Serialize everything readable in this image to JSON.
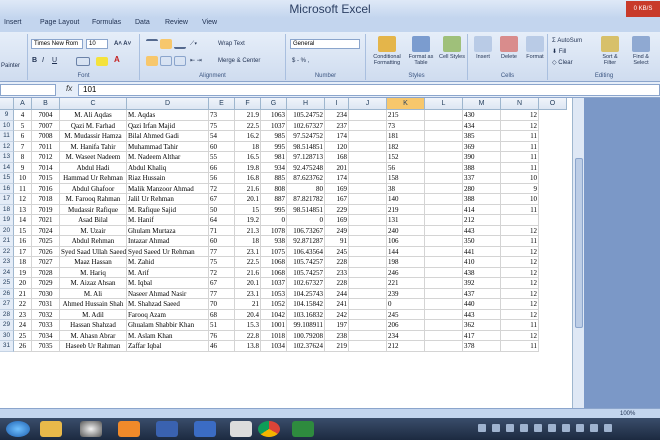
{
  "window": {
    "title": "Microsoft Excel",
    "speed": "0 KB/S"
  },
  "tabs": [
    "Insert",
    "Page Layout",
    "Formulas",
    "Data",
    "Review",
    "View"
  ],
  "ribbon": {
    "painter": "Painter",
    "font_name": "Times New Rom",
    "font_size": "10",
    "group_font": "Font",
    "wrap_text": "Wrap Text",
    "merge_center": "Merge & Center",
    "group_alignment": "Alignment",
    "number_format": "General",
    "number_symbols": "$ - % ,",
    "group_number": "Number",
    "conditional_formatting": "Conditional Formatting",
    "format_as_table": "Format as Table",
    "cell_styles": "Cell Styles",
    "group_styles": "Styles",
    "insert": "Insert",
    "delete": "Delete",
    "format": "Format",
    "group_cells": "Cells",
    "autosum": "AutoSum",
    "fill": "Fill",
    "clear": "Clear",
    "sort_filter": "Sort & Filter",
    "find_select": "Find & Select",
    "group_editing": "Editing"
  },
  "formula_bar": {
    "fx": "fx",
    "value": "101"
  },
  "columns": [
    "A",
    "B",
    "C",
    "D",
    "E",
    "F",
    "G",
    "H",
    "I",
    "J",
    "K",
    "L",
    "M",
    "N",
    "O"
  ],
  "rows": [
    [
      "9",
      "4",
      "7004",
      "M. Ali Aqdas",
      "M. Aqdas",
      "73",
      "21.9",
      "1063",
      "105.24752",
      "234",
      "",
      "215",
      "",
      "430",
      "12"
    ],
    [
      "10",
      "5",
      "7007",
      "Qazi M. Farhad",
      "Qazi Irfan Majid",
      "75",
      "22.5",
      "1037",
      "102.67327",
      "237",
      "",
      "73",
      "",
      "434",
      "12"
    ],
    [
      "11",
      "6",
      "7008",
      "M. Mudassir Hamza",
      "Bilal Ahmed Gadi",
      "54",
      "16.2",
      "985",
      "97.524752",
      "174",
      "",
      "181",
      "",
      "385",
      "11"
    ],
    [
      "12",
      "7",
      "7011",
      "M. Hanifa Tahir",
      "Muhammad Tahir",
      "60",
      "18",
      "995",
      "98.514851",
      "120",
      "",
      "182",
      "",
      "369",
      "11"
    ],
    [
      "13",
      "8",
      "7012",
      "M. Waseet Nadeem",
      "M. Nadeem Althar",
      "55",
      "16.5",
      "981",
      "97.128713",
      "168",
      "",
      "152",
      "",
      "390",
      "11"
    ],
    [
      "14",
      "9",
      "7014",
      "Abdul Hadi",
      "Abdul Khaliq",
      "66",
      "19.8",
      "934",
      "92.475248",
      "201",
      "",
      "56",
      "",
      "388",
      "11"
    ],
    [
      "15",
      "10",
      "7015",
      "Hammad Ur Rehman",
      "Riaz Hussain",
      "56",
      "16.8",
      "885",
      "87.623762",
      "174",
      "",
      "158",
      "",
      "337",
      "10"
    ],
    [
      "16",
      "11",
      "7016",
      "Abdul Ghafoor",
      "Malik Manzoor Ahmad",
      "72",
      "21.6",
      "808",
      "80",
      "169",
      "",
      "38",
      "",
      "280",
      "9"
    ],
    [
      "17",
      "12",
      "7018",
      "M. Farooq Rahman",
      "Jalil Ur Rehman",
      "67",
      "20.1",
      "887",
      "87.821782",
      "167",
      "",
      "140",
      "",
      "388",
      "10"
    ],
    [
      "18",
      "13",
      "7019",
      "Mudassir Rafique",
      "M. Rafique Sajid",
      "50",
      "15",
      "995",
      "98.514851",
      "229",
      "",
      "219",
      "",
      "414",
      "11"
    ],
    [
      "19",
      "14",
      "7021",
      "Asad Bilal",
      "M. Hanif",
      "64",
      "19.2",
      "0",
      "0",
      "169",
      "",
      "131",
      "",
      "212",
      ""
    ],
    [
      "20",
      "15",
      "7024",
      "M. Uzair",
      "Ghulam Murtaza",
      "71",
      "21.3",
      "1078",
      "106.73267",
      "249",
      "",
      "240",
      "",
      "443",
      "12"
    ],
    [
      "21",
      "16",
      "7025",
      "Abdul Rehman",
      "Intazar Ahmad",
      "60",
      "18",
      "938",
      "92.871287",
      "91",
      "",
      "106",
      "",
      "350",
      "11"
    ],
    [
      "22",
      "17",
      "7026",
      "Syed Saad Ullah Saeed",
      "Syed Saeed Ur Rehman",
      "77",
      "23.1",
      "1075",
      "106.43564",
      "245",
      "",
      "144",
      "",
      "441",
      "12"
    ],
    [
      "23",
      "18",
      "7027",
      "Maaz Hassan",
      "M. Zahid",
      "75",
      "22.5",
      "1068",
      "105.74257",
      "228",
      "",
      "198",
      "",
      "410",
      "12"
    ],
    [
      "24",
      "19",
      "7028",
      "M. Hariq",
      "M. Arif",
      "72",
      "21.6",
      "1068",
      "105.74257",
      "233",
      "",
      "246",
      "",
      "438",
      "12"
    ],
    [
      "25",
      "20",
      "7029",
      "M. Aizaz Ahsan",
      "M. Iqbal",
      "67",
      "20.1",
      "1037",
      "102.67327",
      "228",
      "",
      "221",
      "",
      "392",
      "12"
    ],
    [
      "26",
      "21",
      "7030",
      "M. Ali",
      "Naseer Ahmad Nasir",
      "77",
      "23.1",
      "1053",
      "104.25743",
      "244",
      "",
      "239",
      "",
      "437",
      "12"
    ],
    [
      "27",
      "22",
      "7031",
      "Ahmed Hussain Shah",
      "M. Shahzad Saeed",
      "70",
      "21",
      "1052",
      "104.15842",
      "241",
      "",
      "0",
      "",
      "440",
      "12"
    ],
    [
      "28",
      "23",
      "7032",
      "M. Adil",
      "Farooq Azam",
      "68",
      "20.4",
      "1042",
      "103.16832",
      "242",
      "",
      "245",
      "",
      "443",
      "12"
    ],
    [
      "29",
      "24",
      "7033",
      "Hassan Shahzad",
      "Ghualam Shabbir Khan",
      "51",
      "15.3",
      "1001",
      "99.108911",
      "197",
      "",
      "206",
      "",
      "362",
      "11"
    ],
    [
      "30",
      "25",
      "7034",
      "M. Ahasn Abrar",
      "M. Aslam Khan",
      "76",
      "22.8",
      "1018",
      "100.79208",
      "238",
      "",
      "234",
      "",
      "417",
      "12"
    ],
    [
      "31",
      "26",
      "7035",
      "Haseeb Ur Rahman",
      "Zaffar Iqbal",
      "46",
      "13.8",
      "1034",
      "102.37624",
      "219",
      "",
      "212",
      "",
      "378",
      "11"
    ]
  ],
  "status": {
    "zoom": "100%"
  },
  "colors": {
    "accent": "#4a6fa5",
    "selected_header": "#f7c76c",
    "ribbon": "#dfe9f7"
  },
  "taskbar_icons": [
    "start-orb-icon",
    "explorer-icon",
    "media-player-icon",
    "firefox-icon",
    "word-icon",
    "document-icon",
    "chrome-icon",
    "excel-icon"
  ]
}
